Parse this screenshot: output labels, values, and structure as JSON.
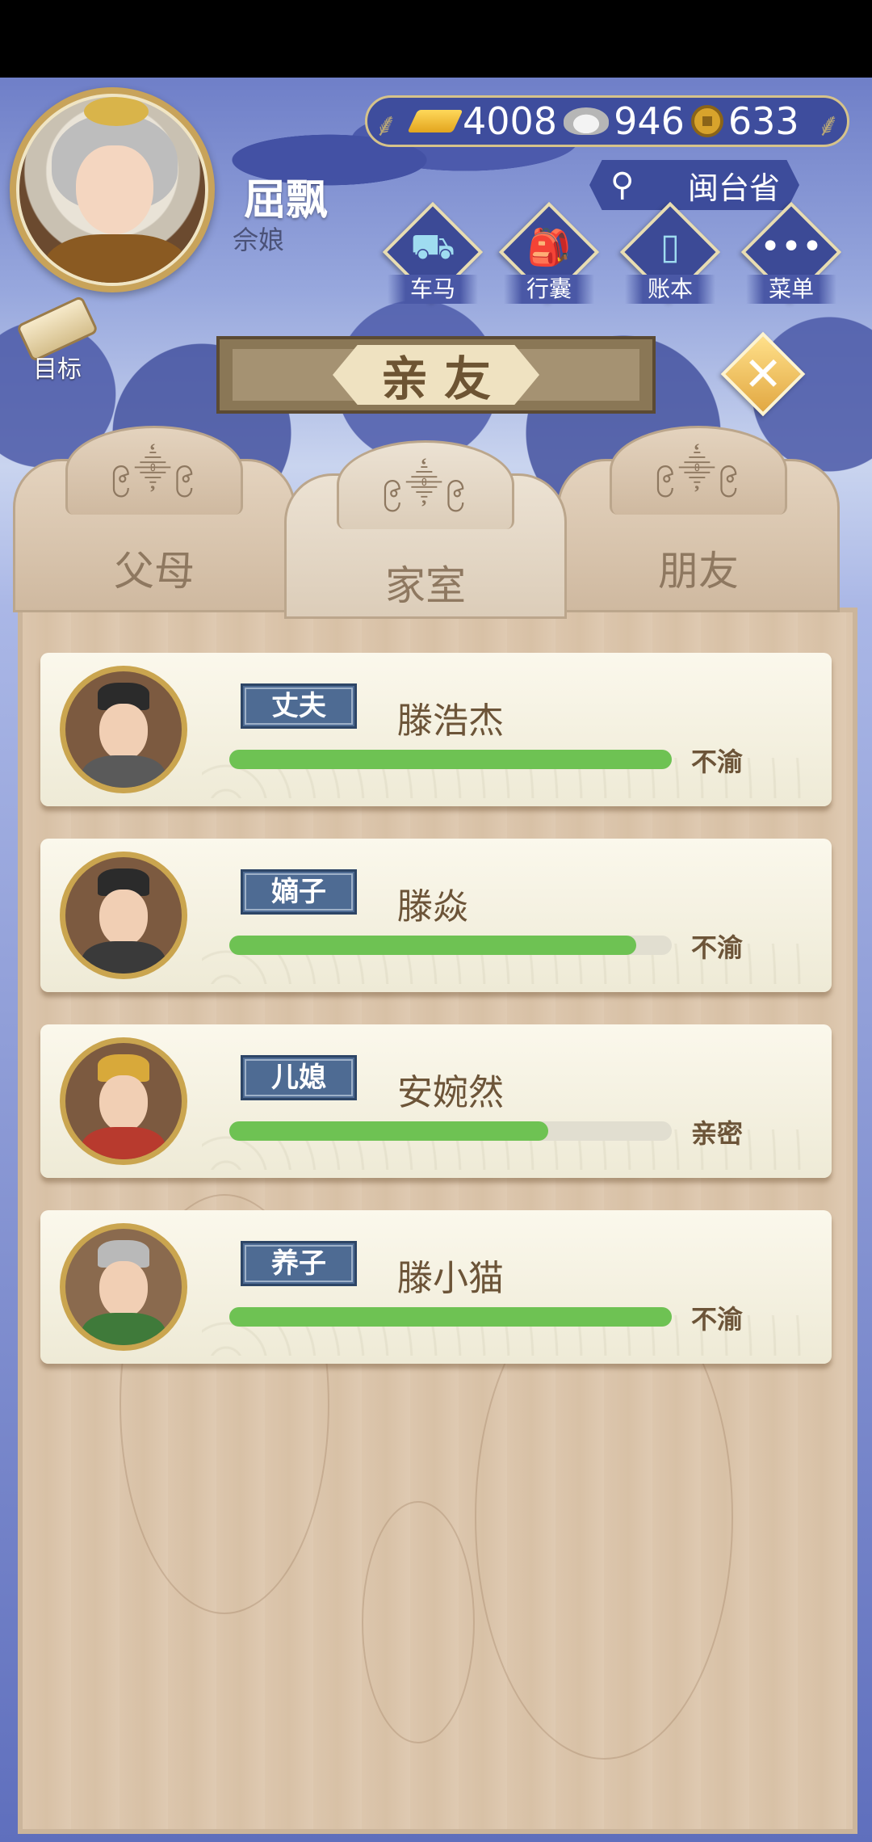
{
  "player": {
    "name": "屈飘",
    "title": "佘娘"
  },
  "currency": {
    "gold": "4008",
    "silver": "946",
    "coins": "633"
  },
  "location": "闽台省",
  "menu": [
    {
      "label": "车马",
      "icon": "carriage-icon"
    },
    {
      "label": "行囊",
      "icon": "bag-icon"
    },
    {
      "label": "账本",
      "icon": "ledger-icon"
    },
    {
      "label": "菜单",
      "icon": "more-icon"
    }
  ],
  "goal_label": "目标",
  "page_title": "亲友",
  "tabs": [
    {
      "label": "父母",
      "active": false
    },
    {
      "label": "家室",
      "active": true
    },
    {
      "label": "朋友",
      "active": false
    }
  ],
  "members": [
    {
      "role": "丈夫",
      "name": "滕浩杰",
      "relation": "不渝",
      "affinity": 1.0
    },
    {
      "role": "嫡子",
      "name": "滕焱",
      "relation": "不渝",
      "affinity": 0.92
    },
    {
      "role": "儿媳",
      "name": "安婉然",
      "relation": "亲密",
      "affinity": 0.72
    },
    {
      "role": "养子",
      "name": "滕小猫",
      "relation": "不渝",
      "affinity": 1.0
    }
  ],
  "colors": {
    "accent": "#3e4d9d",
    "bar": "#6ec253",
    "badge": "#4e6b93"
  }
}
